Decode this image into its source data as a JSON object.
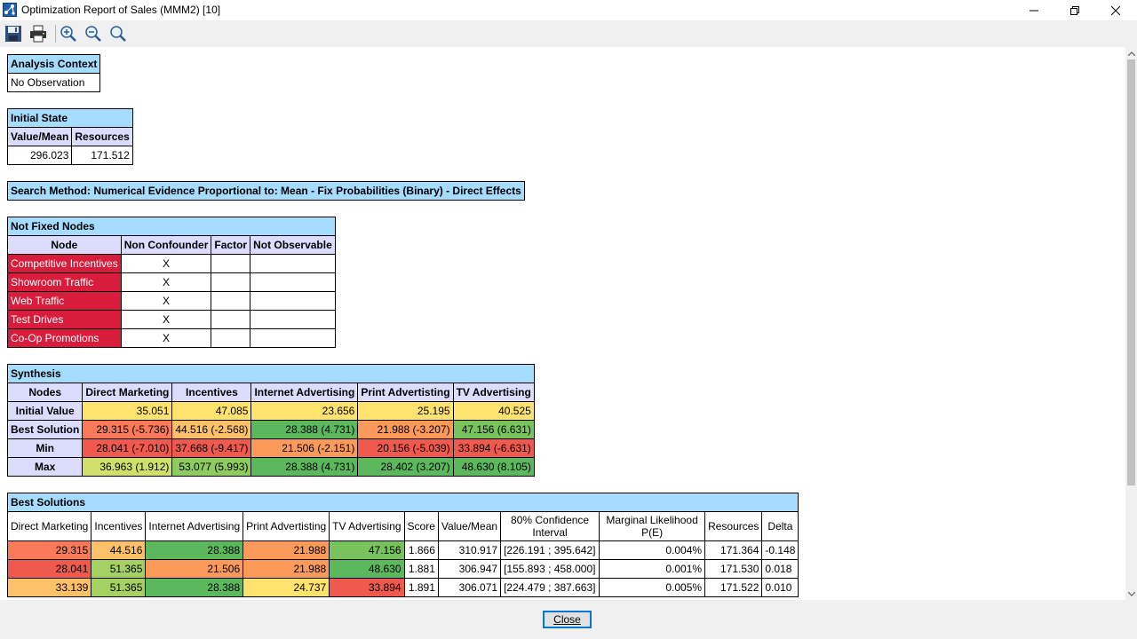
{
  "window": {
    "title": "Optimization Report of Sales (MMM2) [10]"
  },
  "close_label": "Close",
  "analysis_context": {
    "header": "Analysis Context",
    "value": "No Observation"
  },
  "initial_state": {
    "header": "Initial State",
    "cols": [
      "Value/Mean",
      "Resources"
    ],
    "values": [
      "296.023",
      "171.512"
    ]
  },
  "search_method": "Search Method: Numerical Evidence Proportional to: Mean - Fix Probabilities (Binary) - Direct Effects",
  "not_fixed": {
    "header": "Not Fixed Nodes",
    "cols": [
      "Node",
      "Non Confounder",
      "Factor",
      "Not Observable"
    ],
    "rows": [
      {
        "name": "Competitive Incentives",
        "non_confounder": "X",
        "factor": "",
        "not_observable": ""
      },
      {
        "name": "Showroom Traffic",
        "non_confounder": "X",
        "factor": "",
        "not_observable": ""
      },
      {
        "name": "Web Traffic",
        "non_confounder": "X",
        "factor": "",
        "not_observable": ""
      },
      {
        "name": "Test Drives",
        "non_confounder": "X",
        "factor": "",
        "not_observable": ""
      },
      {
        "name": "Co-Op Promotions",
        "non_confounder": "X",
        "factor": "",
        "not_observable": ""
      }
    ]
  },
  "synthesis": {
    "header": "Synthesis",
    "cols": [
      "Nodes",
      "Direct Marketing",
      "Incentives",
      "Internet Advertising",
      "Print Advertisting",
      "TV Advertising"
    ],
    "rows": [
      {
        "label": "Initial Value",
        "cells": [
          {
            "v": "35.051",
            "c": "#ffe36e"
          },
          {
            "v": "47.085",
            "c": "#ffe36e"
          },
          {
            "v": "23.656",
            "c": "#ffe36e"
          },
          {
            "v": "25.195",
            "c": "#ffe36e"
          },
          {
            "v": "40.525",
            "c": "#ffe36e"
          }
        ]
      },
      {
        "label": "Best Solution",
        "cells": [
          {
            "v": "29.315 (-5.736)",
            "c": "#f87a5a"
          },
          {
            "v": "44.516 (-2.568)",
            "c": "#ffc06a"
          },
          {
            "v": "28.388 (4.731)",
            "c": "#5cb85c"
          },
          {
            "v": "21.988 (-3.207)",
            "c": "#fc9a5c"
          },
          {
            "v": "47.156 (6.631)",
            "c": "#79c35d"
          }
        ]
      },
      {
        "label": "Min",
        "cells": [
          {
            "v": "28.041 (-7.010)",
            "c": "#f05a4e"
          },
          {
            "v": "37.668 (-9.417)",
            "c": "#f05a4e"
          },
          {
            "v": "21.506 (-2.151)",
            "c": "#fc9a5c"
          },
          {
            "v": "20.156 (-5.039)",
            "c": "#f05a4e"
          },
          {
            "v": "33.894 (-6.631)",
            "c": "#f05a4e"
          }
        ]
      },
      {
        "label": "Max",
        "cells": [
          {
            "v": "36.963 (1.912)",
            "c": "#cfe16a"
          },
          {
            "v": "53.077 (5.993)",
            "c": "#8ecb60"
          },
          {
            "v": "28.388 (4.731)",
            "c": "#5cb85c"
          },
          {
            "v": "28.402 (3.207)",
            "c": "#5cb85c"
          },
          {
            "v": "48.630 (8.105)",
            "c": "#5cb85c"
          }
        ]
      }
    ]
  },
  "best_solutions": {
    "header": "Best Solutions",
    "cols": [
      "Direct Marketing",
      "Incentives",
      "Internet Advertising",
      "Print Advertisting",
      "TV Advertising",
      "Score",
      "Value/Mean",
      "80% Confidence Interval",
      "Marginal Likelihood P(E)",
      "Resources",
      "Delta"
    ],
    "rows": [
      {
        "dm": {
          "v": "29.315",
          "c": "#f87a5a"
        },
        "inc": {
          "v": "44.516",
          "c": "#ffc06a"
        },
        "ia": {
          "v": "28.388",
          "c": "#5cb85c"
        },
        "pa": {
          "v": "21.988",
          "c": "#fc9a5c"
        },
        "tv": {
          "v": "47.156",
          "c": "#79c35d"
        },
        "score": "1.866",
        "value": "310.917",
        "ci": "[226.191 ; 395.642]",
        "ml": "0.004%",
        "res": "171.364",
        "delta": "-0.148"
      },
      {
        "dm": {
          "v": "28.041",
          "c": "#f05a4e"
        },
        "inc": {
          "v": "51.365",
          "c": "#a5d162"
        },
        "ia": {
          "v": "21.506",
          "c": "#fc9a5c"
        },
        "pa": {
          "v": "21.988",
          "c": "#fc9a5c"
        },
        "tv": {
          "v": "48.630",
          "c": "#5cb85c"
        },
        "score": "1.881",
        "value": "306.947",
        "ci": "[155.893 ; 458.000]",
        "ml": "0.001%",
        "res": "171.530",
        "delta": "0.018"
      },
      {
        "dm": {
          "v": "33.139",
          "c": "#ffc06a"
        },
        "inc": {
          "v": "51.365",
          "c": "#a5d162"
        },
        "ia": {
          "v": "28.388",
          "c": "#5cb85c"
        },
        "pa": {
          "v": "24.737",
          "c": "#ffe36e"
        },
        "tv": {
          "v": "33.894",
          "c": "#f05a4e"
        },
        "score": "1.891",
        "value": "306.071",
        "ci": "[224.479 ; 387.663]",
        "ml": "0.005%",
        "res": "171.522",
        "delta": "0.010"
      }
    ]
  },
  "icons": [
    "save-icon",
    "print-icon",
    "zoom-in-icon",
    "zoom-out-icon",
    "zoom-reset-icon"
  ]
}
